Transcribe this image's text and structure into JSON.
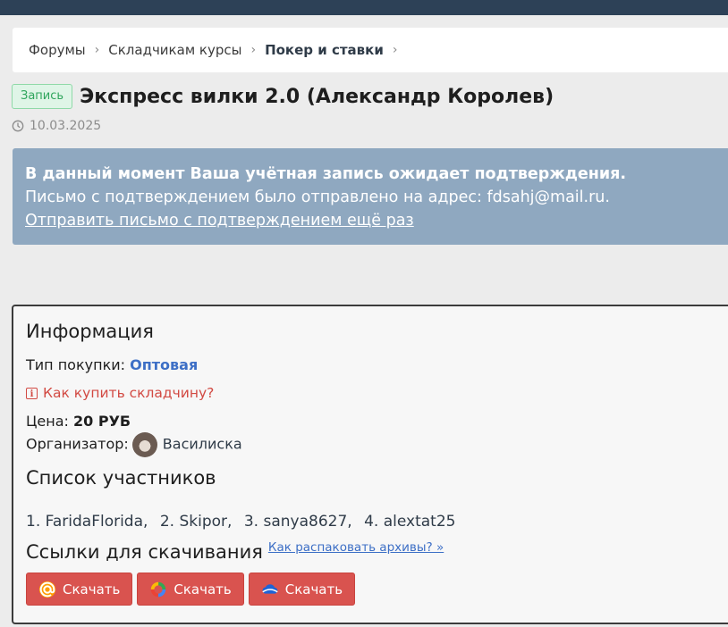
{
  "breadcrumb": {
    "items": [
      "Форумы",
      "Складчикам курсы",
      "Покер и ставки"
    ],
    "separator": "›"
  },
  "thread": {
    "tag": "Запись",
    "title": "Экспресс вилки 2.0 (Александр Королев)",
    "date": "10.03.2025"
  },
  "notice": {
    "line1": "В данный момент Ваша учётная запись ожидает подтверждения.",
    "line2": "Письмо с подтверждением было отправлено на адрес: fdsahj@mail.ru.",
    "link": "Отправить письмо с подтверждением ещё раз"
  },
  "info": {
    "heading": "Информация",
    "purchase_type_label": "Тип покупки:",
    "purchase_type_value": "Оптовая",
    "how_to_buy": "Как купить складчину?",
    "price_label": "Цена:",
    "price_value": "20 РУБ",
    "organizer_label": "Организатор:",
    "organizer_name": "Василиска"
  },
  "participants": {
    "heading": "Список участников",
    "list": [
      {
        "num": "1.",
        "name": "FaridaFlorida"
      },
      {
        "num": "2.",
        "name": "Skipor"
      },
      {
        "num": "3.",
        "name": "sanya8627"
      },
      {
        "num": "4.",
        "name": "alextat25"
      }
    ]
  },
  "downloads": {
    "heading": "Ссылки для скачивания",
    "unpack_link": "Как распаковать архивы? »",
    "buttons": [
      {
        "label": "Скачать",
        "icon": "mail-ru-icon"
      },
      {
        "label": "Скачать",
        "icon": "google-drive-icon"
      },
      {
        "label": "Скачать",
        "icon": "cloud-icon"
      }
    ]
  },
  "colors": {
    "topbar": "#2d4157",
    "notice": "#8fa8c0",
    "accent_blue": "#3d6fc6",
    "danger": "#d9534f",
    "tag_green": "#2fa55c"
  }
}
